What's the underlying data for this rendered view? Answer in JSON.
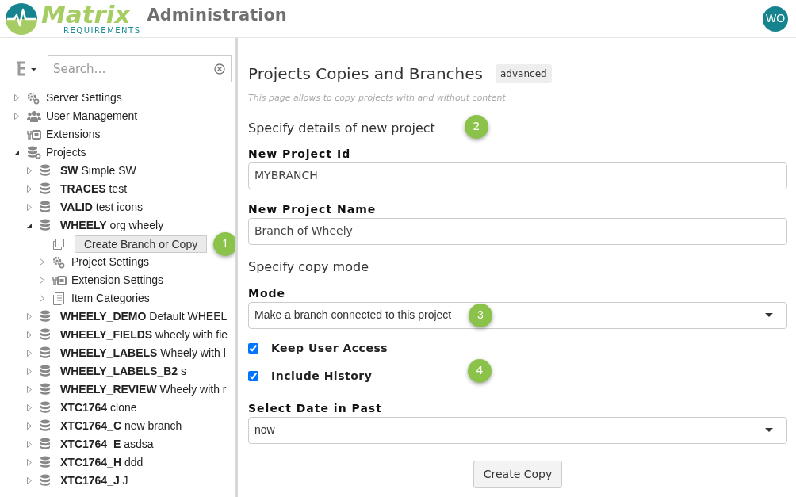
{
  "header": {
    "logo_word": "Matrix",
    "logo_tagline": "REQUIREMENTS",
    "title": "Administration",
    "avatar": "WO"
  },
  "sidebar": {
    "search": {
      "placeholder": "Search…"
    },
    "tree": [
      {
        "kind": "settings",
        "name": "Server Settings",
        "expanded": false
      },
      {
        "kind": "users",
        "name": "User Management",
        "expanded": false
      },
      {
        "kind": "extensions",
        "name": "Extensions"
      },
      {
        "kind": "projects",
        "name": "Projects",
        "expanded": true,
        "children": [
          {
            "kind": "project",
            "id": "SW",
            "name": "Simple SW",
            "expanded": false
          },
          {
            "kind": "project",
            "id": "TRACES",
            "name": "test",
            "expanded": false
          },
          {
            "kind": "project",
            "id": "VALID",
            "name": "test icons",
            "expanded": false
          },
          {
            "kind": "project",
            "id": "WHEELY",
            "name": "org wheely",
            "expanded": true,
            "children": [
              {
                "kind": "action",
                "name": "Create Branch or Copy",
                "selected": true,
                "callout": "1"
              },
              {
                "kind": "settings",
                "name": "Project Settings",
                "expanded": false
              },
              {
                "kind": "extensions",
                "name": "Extension Settings",
                "expanded": false
              },
              {
                "kind": "categories",
                "name": "Item Categories",
                "expanded": false
              }
            ]
          },
          {
            "kind": "project",
            "id": "WHEELY_DEMO",
            "name": "Default WHEEL",
            "expanded": false
          },
          {
            "kind": "project",
            "id": "WHEELY_FIELDS",
            "name": "wheely with fie",
            "expanded": false
          },
          {
            "kind": "project",
            "id": "WHEELY_LABELS",
            "name": "Wheely with l",
            "expanded": false
          },
          {
            "kind": "project",
            "id": "WHEELY_LABELS_B2",
            "name": "s",
            "expanded": false
          },
          {
            "kind": "project",
            "id": "WHEELY_REVIEW",
            "name": "Wheely with r",
            "expanded": false
          },
          {
            "kind": "project",
            "id": "XTC1764",
            "name": "clone",
            "expanded": false
          },
          {
            "kind": "project",
            "id": "XTC1764_C",
            "name": "new branch",
            "expanded": false
          },
          {
            "kind": "project",
            "id": "XTC1764_E",
            "name": "asdsa",
            "expanded": false
          },
          {
            "kind": "project",
            "id": "XTC1764_H",
            "name": "ddd",
            "expanded": false
          },
          {
            "kind": "project",
            "id": "XTC1764_J",
            "name": "J",
            "expanded": false
          }
        ]
      }
    ]
  },
  "main": {
    "title": "Projects Copies and Branches",
    "badge": "advanced",
    "subtitle": "This page allows to copy projects with and without content",
    "details_heading": "Specify details of new project",
    "details_callout": "2",
    "fields": [
      {
        "label": "New Project Id",
        "value": "MYBRANCH"
      },
      {
        "label": "New Project Name",
        "value": "Branch of Wheely"
      }
    ],
    "mode_heading": "Specify copy mode",
    "mode": {
      "label": "Mode",
      "value": "Make a branch connected to this project",
      "callout": "3"
    },
    "options": [
      {
        "label": "Keep User Access",
        "checked": true
      },
      {
        "label": "Include History",
        "checked": true
      }
    ],
    "options_callout": "4",
    "date": {
      "label": "Select Date in Past",
      "value": "now"
    },
    "button": "Create Copy"
  }
}
